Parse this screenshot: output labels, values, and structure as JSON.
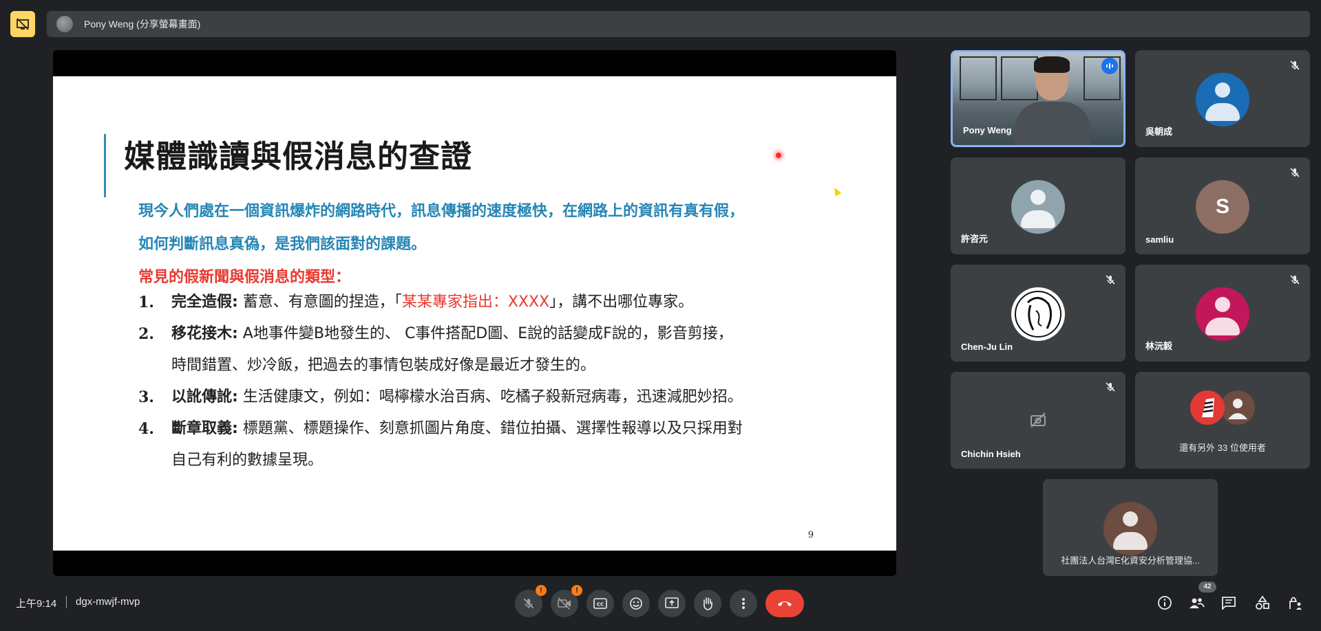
{
  "presenter_bar": {
    "label": "Pony Weng (分享螢幕畫面)"
  },
  "slide": {
    "title": "媒體識讀與假消息的查證",
    "intro_line1": "現今人們處在一個資訊爆炸的網路時代，訊息傳播的速度極快，在網路上的資訊有真有假，",
    "intro_line2": "如何判斷訊息真偽，是我們該面對的課題。",
    "types_heading": "常見的假新聞與假消息的類型：",
    "items": [
      {
        "num": "1.",
        "head": "完全造假:",
        "text_a": " 蓄意、有意圖的捏造，「",
        "quote": "某某專家指出：XXXX",
        "text_b": "」，講不出哪位專家。"
      },
      {
        "num": "2.",
        "head": "移花接木:",
        "text": " A地事件變B地發生的、 C事件搭配D圖、E說的話變成F說的，影音剪接，",
        "text2": "時間錯置、炒冷飯，把過去的事情包裝成好像是最近才發生的。"
      },
      {
        "num": "3.",
        "head": "以訛傳訛:",
        "text": " 生活健康文，例如：喝檸檬水治百病、吃橘子殺新冠病毒，迅速減肥妙招。"
      },
      {
        "num": "4.",
        "head": "斷章取義:",
        "text": " 標題黨、標題操作、刻意抓圖片角度、錯位拍攝、選擇性報導以及只採用對",
        "text2": "自己有利的數據呈現。"
      }
    ],
    "page_number": "9"
  },
  "participants": [
    {
      "name": "Pony Weng"
    },
    {
      "name": "吳朝成",
      "avatar_color": "#1a6db5"
    },
    {
      "name": "許咨元",
      "avatar_color": "#90a4ae"
    },
    {
      "name": "samliu",
      "letter": "S",
      "avatar_color": "#8d6e63"
    },
    {
      "name": "Chen-Ju Lin"
    },
    {
      "name": "林沅毅",
      "avatar_color": "#c2185b"
    },
    {
      "name": "Chichin Hsieh"
    },
    {
      "name": "還有另外 33 位使用者"
    },
    {
      "name": "社團法人台灣E化資安分析管理協..."
    }
  ],
  "bottom_bar": {
    "time": "上午9:14",
    "meeting_code": "dgx-mwjf-mvp",
    "mic_warning": "!",
    "camera_warning": "!",
    "people_count": "42"
  },
  "colors": {
    "background": "#202124",
    "tile": "#3c4043",
    "active_speaker_border": "#8ab4f8",
    "leave": "#ea4335",
    "warning": "#fa7b17",
    "stop_present": "#fdd663"
  }
}
